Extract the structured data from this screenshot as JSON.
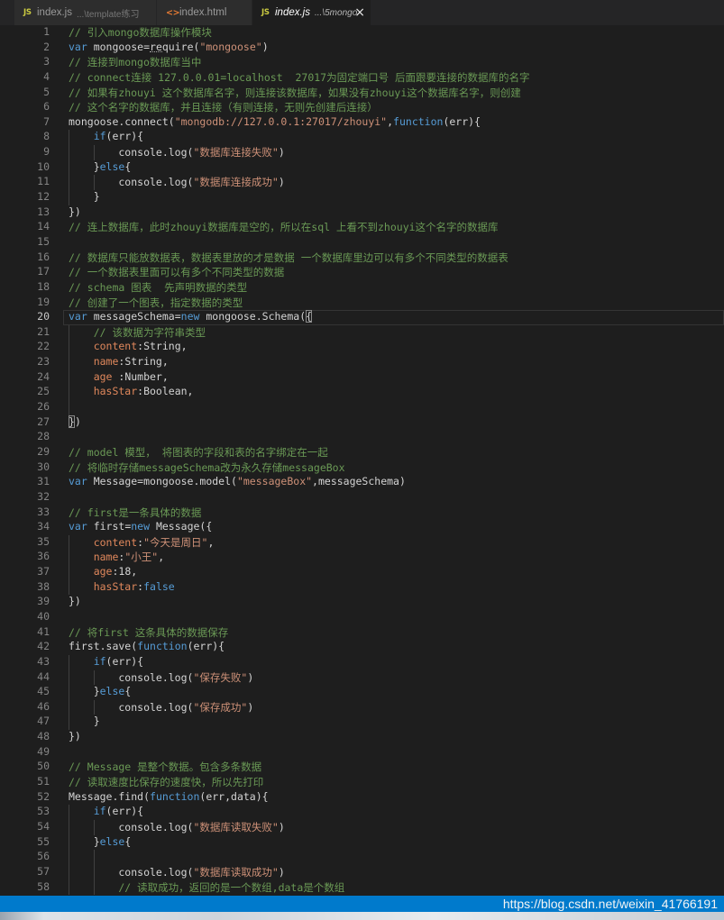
{
  "tabs": [
    {
      "icon_text": "JS",
      "label": "index.js",
      "description": "...\\template练习"
    },
    {
      "icon_text": "<>",
      "label": "index.html",
      "description": ""
    },
    {
      "icon_text": "JS",
      "label": "index.js",
      "description": "...\\5mongo",
      "close_label": "×"
    }
  ],
  "syntax_colors": {
    "plain": "#d4d4d4",
    "keyword": "#569cd6",
    "string": "#ce9178",
    "comment": "#6a9955",
    "property": "#e0885c",
    "bracket": "#d4d4d4",
    "hint": "#d4d4d4"
  },
  "editor": {
    "active_line": 20,
    "lines": [
      {
        "n": "1",
        "indent": 0,
        "tokens": [
          [
            "comment",
            "// 引入mongo数据库操作模块"
          ]
        ]
      },
      {
        "n": "2",
        "indent": 0,
        "tokens": [
          [
            "keyword",
            "var"
          ],
          [
            "plain",
            " mongoose="
          ],
          [
            "hint",
            "require"
          ],
          [
            "plain",
            "("
          ],
          [
            "string",
            "\"mongoose\""
          ],
          [
            "plain",
            ")"
          ]
        ]
      },
      {
        "n": "3",
        "indent": 0,
        "tokens": [
          [
            "comment",
            "// 连接到mongo数据库当中"
          ]
        ]
      },
      {
        "n": "4",
        "indent": 0,
        "tokens": [
          [
            "comment",
            "// connect连接 127.0.0.01=localhost  27017为固定端口号 后面跟要连接的数据库的名字"
          ]
        ]
      },
      {
        "n": "5",
        "indent": 0,
        "tokens": [
          [
            "comment",
            "// 如果有zhouyi 这个数据库名字，则连接该数据库，如果没有zhouyi这个数据库名字，则创建"
          ]
        ]
      },
      {
        "n": "6",
        "indent": 0,
        "tokens": [
          [
            "comment",
            "// 这个名字的数据库，并且连接（有则连接，无则先创建后连接）"
          ]
        ]
      },
      {
        "n": "7",
        "indent": 0,
        "tokens": [
          [
            "plain",
            "mongoose.connect("
          ],
          [
            "string",
            "\"mongodb://127.0.0.1:27017/zhouyi\""
          ],
          [
            "plain",
            ","
          ],
          [
            "keyword",
            "function"
          ],
          [
            "plain",
            "(err){"
          ]
        ]
      },
      {
        "n": "8",
        "indent": 1,
        "tokens": [
          [
            "keyword",
            "if"
          ],
          [
            "plain",
            "(err){"
          ]
        ]
      },
      {
        "n": "9",
        "indent": 2,
        "tokens": [
          [
            "plain",
            "console.log("
          ],
          [
            "string",
            "\"数据库连接失败\""
          ],
          [
            "plain",
            ")"
          ]
        ]
      },
      {
        "n": "10",
        "indent": 1,
        "tokens": [
          [
            "plain",
            "}"
          ],
          [
            "keyword",
            "else"
          ],
          [
            "plain",
            "{"
          ]
        ]
      },
      {
        "n": "11",
        "indent": 2,
        "tokens": [
          [
            "plain",
            "console.log("
          ],
          [
            "string",
            "\"数据库连接成功\""
          ],
          [
            "plain",
            ")"
          ]
        ]
      },
      {
        "n": "12",
        "indent": 1,
        "tokens": [
          [
            "plain",
            "}"
          ]
        ]
      },
      {
        "n": "13",
        "indent": 0,
        "tokens": [
          [
            "plain",
            "})"
          ]
        ]
      },
      {
        "n": "14",
        "indent": 0,
        "tokens": [
          [
            "comment",
            "// 连上数据库，此时zhouyi数据库是空的，所以在sql 上看不到zhouyi这个名字的数据库"
          ]
        ]
      },
      {
        "n": "15",
        "indent": 0,
        "tokens": []
      },
      {
        "n": "16",
        "indent": 0,
        "tokens": [
          [
            "comment",
            "// 数据库只能放数据表，数据表里放的才是数据 一个数据库里边可以有多个不同类型的数据表"
          ]
        ]
      },
      {
        "n": "17",
        "indent": 0,
        "tokens": [
          [
            "comment",
            "// 一个数据表里面可以有多个不同类型的数据"
          ]
        ]
      },
      {
        "n": "18",
        "indent": 0,
        "tokens": [
          [
            "comment",
            "// schema 图表  先声明数据的类型"
          ]
        ]
      },
      {
        "n": "19",
        "indent": 0,
        "tokens": [
          [
            "comment",
            "// 创建了一个图表，指定数据的类型"
          ]
        ]
      },
      {
        "n": "20",
        "indent": 0,
        "tokens": [
          [
            "keyword",
            "var"
          ],
          [
            "plain",
            " messageSchema="
          ],
          [
            "keyword",
            "new"
          ],
          [
            "plain",
            " mongoose.Schema("
          ],
          [
            "bracket",
            "{"
          ]
        ]
      },
      {
        "n": "21",
        "indent": 1,
        "tokens": [
          [
            "comment",
            "// 该数据为字符串类型"
          ]
        ]
      },
      {
        "n": "22",
        "indent": 1,
        "tokens": [
          [
            "property",
            "content"
          ],
          [
            "plain",
            ":String,"
          ]
        ]
      },
      {
        "n": "23",
        "indent": 1,
        "tokens": [
          [
            "property",
            "name"
          ],
          [
            "plain",
            ":String,"
          ]
        ]
      },
      {
        "n": "24",
        "indent": 1,
        "tokens": [
          [
            "property",
            "age"
          ],
          [
            "plain",
            " :Number,"
          ]
        ]
      },
      {
        "n": "25",
        "indent": 1,
        "tokens": [
          [
            "property",
            "hasStar"
          ],
          [
            "plain",
            ":Boolean,"
          ]
        ]
      },
      {
        "n": "26",
        "indent": 1,
        "tokens": []
      },
      {
        "n": "27",
        "indent": 0,
        "tokens": [
          [
            "bracket",
            "}"
          ],
          [
            "plain",
            ")"
          ]
        ]
      },
      {
        "n": "28",
        "indent": 0,
        "tokens": []
      },
      {
        "n": "29",
        "indent": 0,
        "tokens": [
          [
            "comment",
            "// model 模型， 将图表的字段和表的名字绑定在一起"
          ]
        ]
      },
      {
        "n": "30",
        "indent": 0,
        "tokens": [
          [
            "comment",
            "// 将临时存储messageSchema改为永久存储messageBox"
          ]
        ]
      },
      {
        "n": "31",
        "indent": 0,
        "tokens": [
          [
            "keyword",
            "var"
          ],
          [
            "plain",
            " Message=mongoose.model("
          ],
          [
            "string",
            "\"messageBox\""
          ],
          [
            "plain",
            ",messageSchema)"
          ]
        ]
      },
      {
        "n": "32",
        "indent": 0,
        "tokens": []
      },
      {
        "n": "33",
        "indent": 0,
        "tokens": [
          [
            "comment",
            "// first是一条具体的数据"
          ]
        ]
      },
      {
        "n": "34",
        "indent": 0,
        "tokens": [
          [
            "keyword",
            "var"
          ],
          [
            "plain",
            " first="
          ],
          [
            "keyword",
            "new"
          ],
          [
            "plain",
            " Message({"
          ]
        ]
      },
      {
        "n": "35",
        "indent": 1,
        "tokens": [
          [
            "property",
            "content"
          ],
          [
            "plain",
            ":"
          ],
          [
            "string",
            "\"今天是周日\""
          ],
          [
            "plain",
            ","
          ]
        ]
      },
      {
        "n": "36",
        "indent": 1,
        "tokens": [
          [
            "property",
            "name"
          ],
          [
            "plain",
            ":"
          ],
          [
            "string",
            "\"小王\""
          ],
          [
            "plain",
            ","
          ]
        ]
      },
      {
        "n": "37",
        "indent": 1,
        "tokens": [
          [
            "property",
            "age"
          ],
          [
            "plain",
            ":18,"
          ]
        ]
      },
      {
        "n": "38",
        "indent": 1,
        "tokens": [
          [
            "property",
            "hasStar"
          ],
          [
            "plain",
            ":"
          ],
          [
            "keyword",
            "false"
          ]
        ]
      },
      {
        "n": "39",
        "indent": 0,
        "tokens": [
          [
            "plain",
            "})"
          ]
        ]
      },
      {
        "n": "40",
        "indent": 0,
        "tokens": []
      },
      {
        "n": "41",
        "indent": 0,
        "tokens": [
          [
            "comment",
            "// 将first 这条具体的数据保存"
          ]
        ]
      },
      {
        "n": "42",
        "indent": 0,
        "tokens": [
          [
            "plain",
            "first.save("
          ],
          [
            "keyword",
            "function"
          ],
          [
            "plain",
            "(err){"
          ]
        ]
      },
      {
        "n": "43",
        "indent": 1,
        "tokens": [
          [
            "keyword",
            "if"
          ],
          [
            "plain",
            "(err){"
          ]
        ]
      },
      {
        "n": "44",
        "indent": 2,
        "tokens": [
          [
            "plain",
            "console.log("
          ],
          [
            "string",
            "\"保存失败\""
          ],
          [
            "plain",
            ")"
          ]
        ]
      },
      {
        "n": "45",
        "indent": 1,
        "tokens": [
          [
            "plain",
            "}"
          ],
          [
            "keyword",
            "else"
          ],
          [
            "plain",
            "{"
          ]
        ]
      },
      {
        "n": "46",
        "indent": 2,
        "tokens": [
          [
            "plain",
            "console.log("
          ],
          [
            "string",
            "\"保存成功\""
          ],
          [
            "plain",
            ")"
          ]
        ]
      },
      {
        "n": "47",
        "indent": 1,
        "tokens": [
          [
            "plain",
            "}"
          ]
        ]
      },
      {
        "n": "48",
        "indent": 0,
        "tokens": [
          [
            "plain",
            "})"
          ]
        ]
      },
      {
        "n": "49",
        "indent": 0,
        "tokens": []
      },
      {
        "n": "50",
        "indent": 0,
        "tokens": [
          [
            "comment",
            "// Message 是整个数据。包含多条数据"
          ]
        ]
      },
      {
        "n": "51",
        "indent": 0,
        "tokens": [
          [
            "comment",
            "// 读取速度比保存的速度快，所以先打印"
          ]
        ]
      },
      {
        "n": "52",
        "indent": 0,
        "tokens": [
          [
            "plain",
            "Message.find("
          ],
          [
            "keyword",
            "function"
          ],
          [
            "plain",
            "(err,data){"
          ]
        ]
      },
      {
        "n": "53",
        "indent": 1,
        "tokens": [
          [
            "keyword",
            "if"
          ],
          [
            "plain",
            "(err){"
          ]
        ]
      },
      {
        "n": "54",
        "indent": 2,
        "tokens": [
          [
            "plain",
            "console.log("
          ],
          [
            "string",
            "\"数据库读取失败\""
          ],
          [
            "plain",
            ")"
          ]
        ]
      },
      {
        "n": "55",
        "indent": 1,
        "tokens": [
          [
            "plain",
            "}"
          ],
          [
            "keyword",
            "else"
          ],
          [
            "plain",
            "{"
          ]
        ]
      },
      {
        "n": "56",
        "indent": 2,
        "tokens": []
      },
      {
        "n": "57",
        "indent": 2,
        "tokens": [
          [
            "plain",
            "console.log("
          ],
          [
            "string",
            "\"数据库读取成功\""
          ],
          [
            "plain",
            ")"
          ]
        ]
      },
      {
        "n": "58",
        "indent": 2,
        "tokens": [
          [
            "comment",
            "// 读取成功，返回的是一个数组,data是个数组"
          ]
        ]
      }
    ]
  },
  "status_bar": {
    "background": "#007acc",
    "watermark": "https://blog.csdn.net/weixin_41766191"
  }
}
